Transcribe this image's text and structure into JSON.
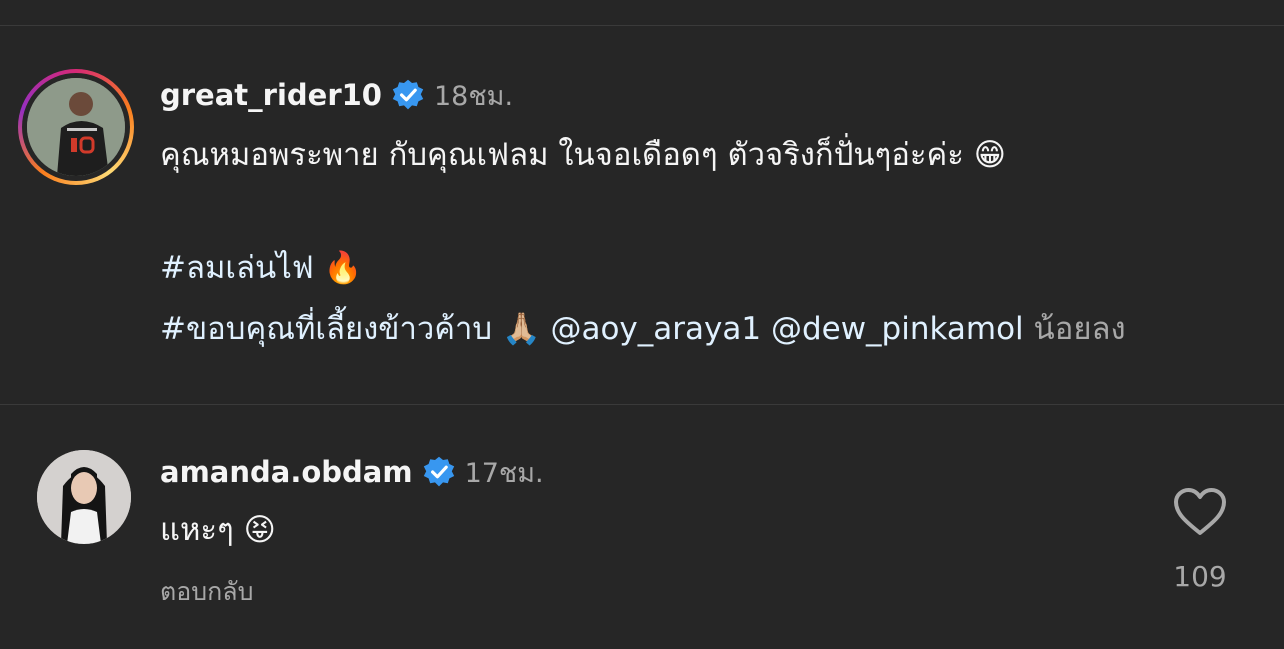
{
  "post": {
    "username": "great_rider10",
    "time": "18ชม.",
    "line1": "คุณหมอพระพาย กับคุณเฟลม ในจอเดือดๆ ตัวจริงก็ปั่นๆอ่ะค่ะ",
    "line1_emoji": "😁",
    "hashtag1": "#ลมเล่นไฟ",
    "hashtag1_emoji": "🔥",
    "hashtag2": "#ขอบคุณที่เลี้ยงข้าวค้าบ",
    "hashtag2_emoji": "🙏🏼",
    "mention1": "@aoy_araya1",
    "mention2": "@dew_pinkamol",
    "less_label": "น้อยลง"
  },
  "comment": {
    "username": "amanda.obdam",
    "time": "17ชม.",
    "text": "แหะๆ",
    "emoji": "😝",
    "reply_label": "ตอบกลับ",
    "like_count": "109"
  },
  "colors": {
    "background": "#262626",
    "verified": "#3897f0",
    "muted": "#a8a8a8"
  }
}
